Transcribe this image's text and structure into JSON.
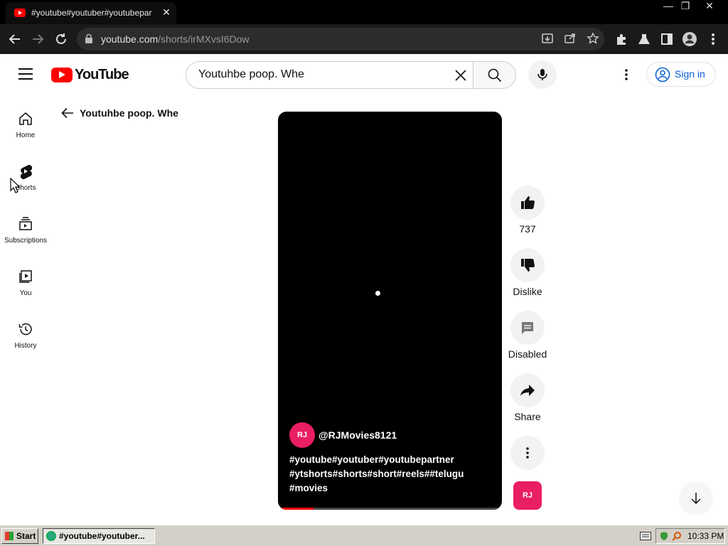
{
  "browser": {
    "tab_title": "#youtube#youtuber#youtubepartne",
    "tab_close": "✕",
    "url_host": "youtube.com",
    "url_path": "/shorts/irMXvsI6Dow",
    "window_controls": [
      "—",
      "❐",
      "✕"
    ]
  },
  "header": {
    "logo_text": "YouTube",
    "search_value": "Youtuhbe poop. Whe",
    "search_clear": "✕",
    "signin_label": "Sign in"
  },
  "sidebar": {
    "items": [
      {
        "label": "Home",
        "icon": "home-icon"
      },
      {
        "label": "Shorts",
        "icon": "shorts-icon"
      },
      {
        "label": "Subscriptions",
        "icon": "subscriptions-icon"
      },
      {
        "label": "You",
        "icon": "you-icon"
      },
      {
        "label": "History",
        "icon": "history-icon"
      }
    ]
  },
  "back": {
    "label": "Youtuhbe poop. Whe"
  },
  "video": {
    "channel_name": "@RJMovies8121",
    "avatar_text": "RJ",
    "description_lines": [
      "#youtube#youtuber#youtubepartner",
      "#ytshorts#shorts#short#reels##telugu",
      "#movies"
    ],
    "progress_fraction": 0.16
  },
  "actions": {
    "like_count": "737",
    "dislike_label": "Dislike",
    "comments_label": "Disabled",
    "share_label": "Share",
    "sound_text": "RJ"
  },
  "taskbar": {
    "start_label": "Start",
    "task_label": "#youtube#youtuber...",
    "clock": "10:33 PM"
  }
}
